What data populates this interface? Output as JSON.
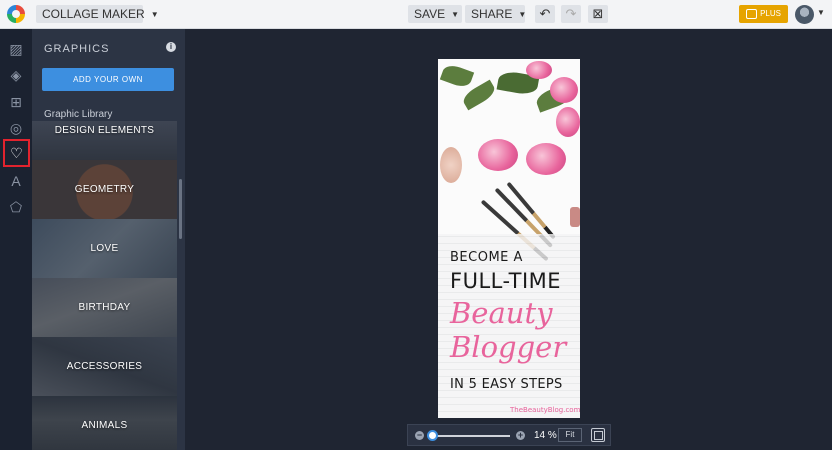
{
  "toolbar": {
    "mode_label": "COLLAGE MAKER",
    "save_label": "SAVE",
    "share_label": "SHARE",
    "plus_label": "PLUS"
  },
  "rail": {
    "items": [
      "image-icon",
      "paint-bucket-icon",
      "layout-grid-icon",
      "rings-icon",
      "heart-icon",
      "text-icon",
      "eraser-icon"
    ],
    "active": "heart-icon"
  },
  "panel": {
    "title": "GRAPHICS",
    "add_button": "ADD YOUR OWN",
    "library_label": "Graphic Library",
    "tiles": [
      "DESIGN ELEMENTS",
      "GEOMETRY",
      "LOVE",
      "BIRTHDAY",
      "ACCESSORIES",
      "ANIMALS"
    ]
  },
  "canvas": {
    "line1": "BECOME A",
    "line2": "FULL-TIME",
    "line3": "Beauty",
    "line4": "Blogger",
    "line5": "IN 5 EASY STEPS",
    "watermark": "TheBeautyBlog.com"
  },
  "zoom": {
    "value": "14 %",
    "level_percent": 14,
    "fit_label": "Fit"
  },
  "colors": {
    "accent_blue": "#3d8fe0",
    "plus_gold": "#e6a400",
    "active_red": "#e2232e",
    "brand_pink": "#e8649c"
  }
}
